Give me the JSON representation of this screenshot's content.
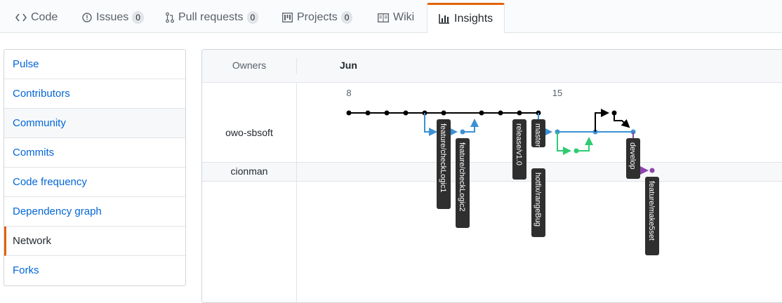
{
  "tabs": [
    {
      "label": "Code",
      "icon": "code-icon"
    },
    {
      "label": "Issues",
      "icon": "issue-icon",
      "count": "0"
    },
    {
      "label": "Pull requests",
      "icon": "pull-request-icon",
      "count": "0"
    },
    {
      "label": "Projects",
      "icon": "project-icon",
      "count": "0"
    },
    {
      "label": "Wiki",
      "icon": "book-icon"
    },
    {
      "label": "Insights",
      "icon": "graph-icon",
      "selected": true
    }
  ],
  "sidebar": {
    "items": [
      {
        "label": "Pulse"
      },
      {
        "label": "Contributors"
      },
      {
        "label": "Community"
      },
      {
        "label": "Commits"
      },
      {
        "label": "Code frequency"
      },
      {
        "label": "Dependency graph"
      },
      {
        "label": "Network",
        "selected": true
      },
      {
        "label": "Forks"
      }
    ]
  },
  "network": {
    "owners_label": "Owners",
    "month": "Jun",
    "dates": [
      "8",
      "15"
    ],
    "owners": [
      "owo-sbsoft",
      "cionman"
    ],
    "branches": [
      "feature/checkLogic1",
      "feature/checkLogic2",
      "release/v1.0",
      "master",
      "hotfix/rangeBug",
      "develop",
      "feature/make5set"
    ]
  },
  "colors": {
    "accent": "#e36209",
    "link": "#0366d6",
    "master_line": "#000000",
    "feature_line": "#3b91d4",
    "hotfix_line": "#2ecc71",
    "fork_line": "#8e44ad"
  }
}
